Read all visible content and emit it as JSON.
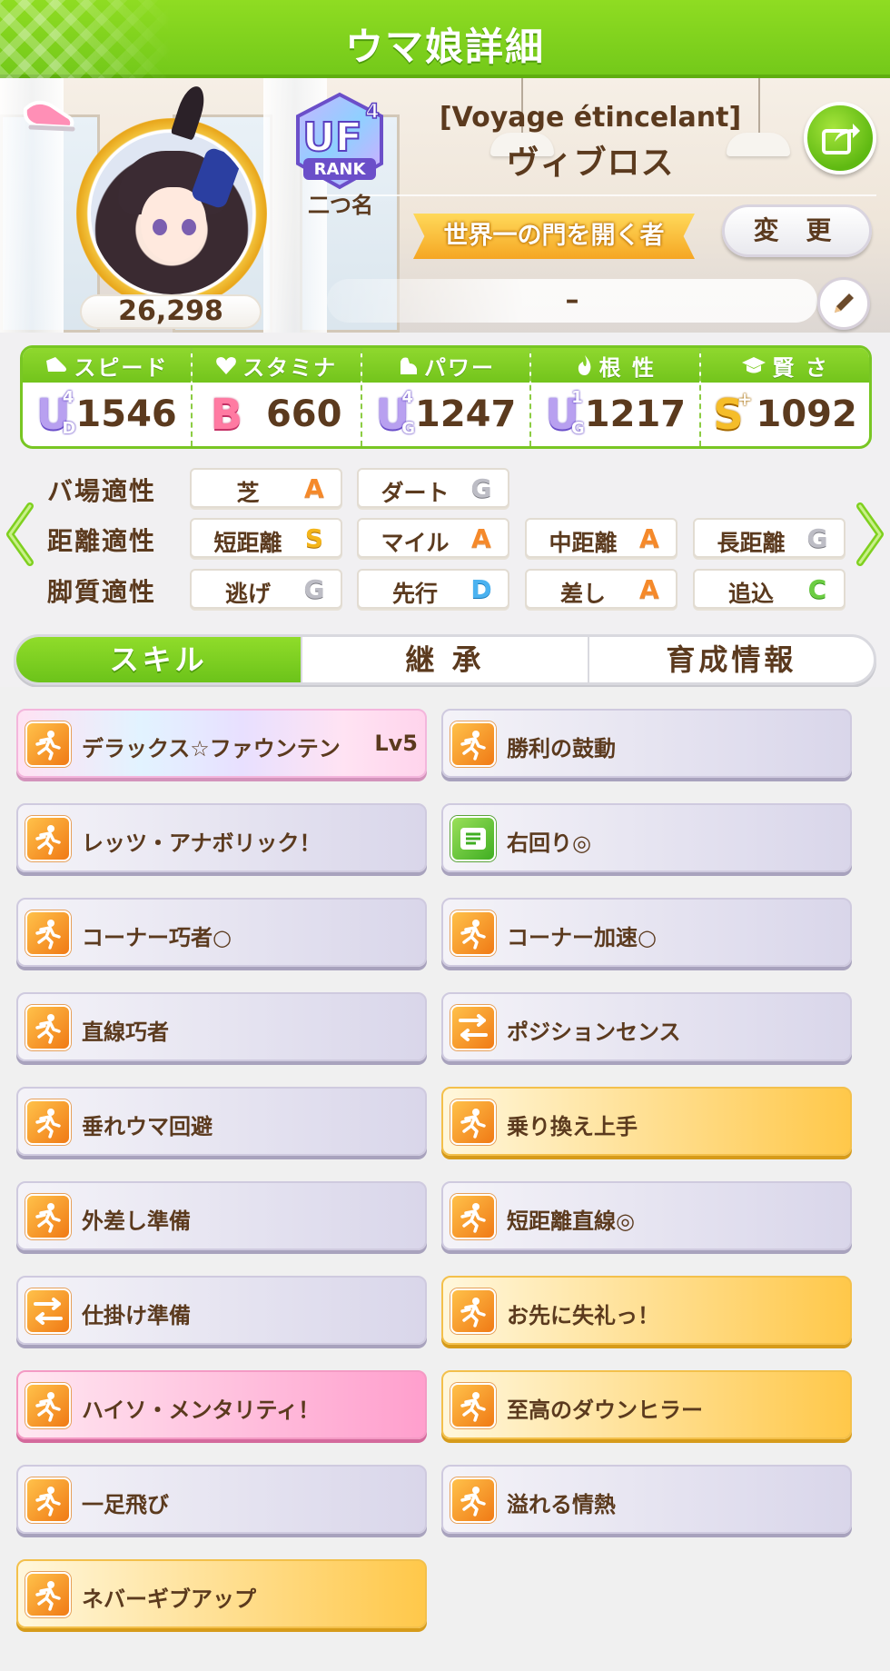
{
  "header": {
    "title": "ウマ娘詳細"
  },
  "profile": {
    "fans": "26,298",
    "rank_label": "二つ名",
    "rank_badge": {
      "letters": "UF",
      "number": "4",
      "caption": "RANK"
    },
    "nickname": "[Voyage étincelant]",
    "name": "ヴィブロス",
    "title_banner": "世界一の門を開く者",
    "change_button": "変 更",
    "status_text": "–"
  },
  "stats": [
    {
      "label": "スピード",
      "icon": "shoe-icon",
      "grade": "U",
      "grade_sub_top": "4",
      "grade_sub_bottom": "D",
      "value": "1546"
    },
    {
      "label": "スタミナ",
      "icon": "heart-icon",
      "grade": "B",
      "value": "660"
    },
    {
      "label": "パワー",
      "icon": "muscle-icon",
      "grade": "U",
      "grade_sub_top": "4",
      "grade_sub_bottom": "G",
      "value": "1247"
    },
    {
      "label": "根 性",
      "icon": "flame-icon",
      "grade": "U",
      "grade_sub_top": "1",
      "grade_sub_bottom": "G",
      "value": "1217"
    },
    {
      "label": "賢 さ",
      "icon": "graduation-cap-icon",
      "grade": "S",
      "grade_plus": "+",
      "value": "1092"
    }
  ],
  "aptitude": {
    "track": {
      "label": "バ場適性",
      "items": [
        {
          "name": "芝",
          "rank": "A"
        },
        {
          "name": "ダート",
          "rank": "G"
        }
      ]
    },
    "distance": {
      "label": "距離適性",
      "items": [
        {
          "name": "短距離",
          "rank": "S"
        },
        {
          "name": "マイル",
          "rank": "A"
        },
        {
          "name": "中距離",
          "rank": "A"
        },
        {
          "name": "長距離",
          "rank": "G"
        }
      ]
    },
    "style": {
      "label": "脚質適性",
      "items": [
        {
          "name": "逃げ",
          "rank": "G"
        },
        {
          "name": "先行",
          "rank": "D"
        },
        {
          "name": "差し",
          "rank": "A"
        },
        {
          "name": "追込",
          "rank": "C"
        }
      ]
    }
  },
  "tabs": [
    "スキル",
    "継 承",
    "育成情報"
  ],
  "skills": [
    {
      "name": "デラックス☆ファウンテン",
      "level": "Lv5",
      "style": "rainbow"
    },
    {
      "name": "勝利の鼓動",
      "style": "normal"
    },
    {
      "name": "レッツ・アナボリック！",
      "style": "normal"
    },
    {
      "name": "右回り◎",
      "style": "normal",
      "icon_color": "green"
    },
    {
      "name": "コーナー巧者○",
      "style": "normal"
    },
    {
      "name": "コーナー加速○",
      "style": "normal"
    },
    {
      "name": "直線巧者",
      "style": "normal"
    },
    {
      "name": "ポジションセンス",
      "style": "normal"
    },
    {
      "name": "垂れウマ回避",
      "style": "normal"
    },
    {
      "name": "乗り換え上手",
      "style": "gold"
    },
    {
      "name": "外差し準備",
      "style": "normal"
    },
    {
      "name": "短距離直線◎",
      "style": "normal"
    },
    {
      "name": "仕掛け準備",
      "style": "normal"
    },
    {
      "name": "お先に失礼っ！",
      "style": "gold"
    },
    {
      "name": "ハイソ・メンタリティ！",
      "style": "pink"
    },
    {
      "name": "至高のダウンヒラー",
      "style": "gold"
    },
    {
      "name": "一足飛び",
      "style": "normal"
    },
    {
      "name": "溢れる情熱",
      "style": "normal"
    },
    {
      "name": "ネバーギブアップ",
      "style": "gold"
    }
  ],
  "colors": {
    "header_green": "#7fd01f",
    "accent_gold": "#f5a623",
    "text_brown": "#5b3a1e"
  }
}
